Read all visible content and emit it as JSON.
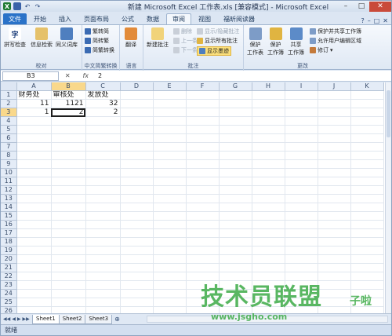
{
  "title_bar": {
    "title": "新建 Microsoft Excel 工作表.xls [兼容模式] - Microsoft Excel",
    "app_icon": "X",
    "buttons": [
      "–",
      "□",
      "✕"
    ]
  },
  "tabs": [
    {
      "label": "文件"
    },
    {
      "label": "开始"
    },
    {
      "label": "插入"
    },
    {
      "label": "页面布局"
    },
    {
      "label": "公式"
    },
    {
      "label": "数据"
    },
    {
      "label": "审阅"
    },
    {
      "label": "视图"
    },
    {
      "label": "福昕阅读器"
    }
  ],
  "ribbon": {
    "proofing": {
      "label": "校对",
      "spell": "拼写检查",
      "research": "信息检索",
      "thesaurus": "同义词库"
    },
    "chinese": {
      "label": "中文简繁转换",
      "to_trad": "繁转简",
      "to_simp": "简转繁",
      "convert": "简繁转换"
    },
    "language": {
      "label": "语言",
      "translate": "翻译"
    },
    "comments": {
      "label": "批注",
      "new": "新建批注",
      "delete": "删除",
      "prev": "上一条",
      "next": "下一条",
      "show_hide": "显示/隐藏批注",
      "show_all": "显示所有批注",
      "show_ink": "显示墨迹"
    },
    "changes": {
      "label": "更改",
      "protect_sheet": "保护\n工作表",
      "protect_book": "保护\n工作簿",
      "share_book": "共享\n工作簿",
      "protect_share": "保护并共享工作簿",
      "allow_edit": "允许用户编辑区域",
      "track": "修订"
    }
  },
  "formula_bar": {
    "name_box": "B3",
    "fx": "fx",
    "value": "2"
  },
  "columns": [
    "A",
    "B",
    "C",
    "D",
    "E",
    "F",
    "G",
    "H",
    "I",
    "J",
    "K"
  ],
  "rows": [
    [
      "财务处",
      "审核处",
      "发放处",
      "",
      "",
      "",
      "",
      "",
      "",
      "",
      ""
    ],
    [
      "11",
      "1121",
      "32",
      "",
      "",
      "",
      "",
      "",
      "",
      "",
      ""
    ],
    [
      "1",
      "2",
      "2",
      "",
      "",
      "",
      "",
      "",
      "",
      "",
      ""
    ]
  ],
  "total_rows": 27,
  "selected_cell": "B3",
  "sheets": [
    "Sheet1",
    "Sheet2",
    "Sheet3"
  ],
  "status": "就绪",
  "watermark": {
    "main": "技术员联盟",
    "url": "www.jsgho.com",
    "side": "子啦"
  }
}
